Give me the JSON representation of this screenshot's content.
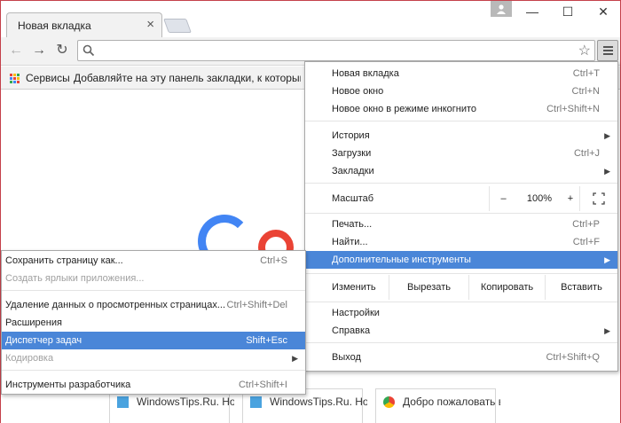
{
  "tab": {
    "title": "Новая вкладка",
    "close": "×"
  },
  "window": {
    "minimize": "—",
    "maximize": "☐",
    "close": "✕"
  },
  "toolbar": {
    "back": "←",
    "forward": "→",
    "reload": "↻",
    "address_value": "",
    "address_placeholder": "",
    "star": "☆"
  },
  "bookmarks": {
    "apps_label": "Сервисы",
    "hint": "Добавляйте на эту панель закладки, к которым хотите"
  },
  "main_menu": {
    "items": [
      {
        "label": "Новая вкладка",
        "shortcut": "Ctrl+T"
      },
      {
        "label": "Новое окно",
        "shortcut": "Ctrl+N"
      },
      {
        "label": "Новое окно в режиме инкогнито",
        "shortcut": "Ctrl+Shift+N"
      },
      {
        "label": "История",
        "shortcut": ""
      },
      {
        "label": "Загрузки",
        "shortcut": "Ctrl+J"
      },
      {
        "label": "Закладки",
        "shortcut": ""
      }
    ],
    "zoom": {
      "label": "Масштаб",
      "minus": "–",
      "value": "100%",
      "plus": "+"
    },
    "items2": [
      {
        "label": "Печать...",
        "shortcut": "Ctrl+P"
      },
      {
        "label": "Найти...",
        "shortcut": "Ctrl+F"
      },
      {
        "label": "Дополнительные инструменты",
        "shortcut": ""
      }
    ],
    "edit": {
      "label": "Изменить",
      "cut": "Вырезать",
      "copy": "Копировать",
      "paste": "Вставить"
    },
    "items3": [
      {
        "label": "Настройки",
        "shortcut": ""
      },
      {
        "label": "Справка",
        "shortcut": ""
      },
      {
        "label": "Выход",
        "shortcut": "Ctrl+Shift+Q"
      }
    ]
  },
  "sub_menu": {
    "items": [
      {
        "label": "Сохранить страницу как...",
        "shortcut": "Ctrl+S"
      },
      {
        "label": "Создать ярлыки приложения...",
        "shortcut": ""
      },
      {
        "label": "Удаление данных о просмотренных страницах...",
        "shortcut": "Ctrl+Shift+Del"
      },
      {
        "label": "Расширения",
        "shortcut": ""
      },
      {
        "label": "Диспетчер задач",
        "shortcut": "Shift+Esc"
      },
      {
        "label": "Кодировка",
        "shortcut": ""
      },
      {
        "label": "Инструменты разработчика",
        "shortcut": "Ctrl+Shift+I"
      }
    ]
  },
  "thumbnails": [
    {
      "title": "WindowsTips.Ru. Нов"
    },
    {
      "title": "WindowsTips.Ru. Нов"
    },
    {
      "title": "Добро пожаловать в"
    }
  ],
  "colors": {
    "highlight": "#4a86d8",
    "frame": "#c4404a",
    "google_blue": "#4285f4",
    "google_red": "#ea4335"
  }
}
